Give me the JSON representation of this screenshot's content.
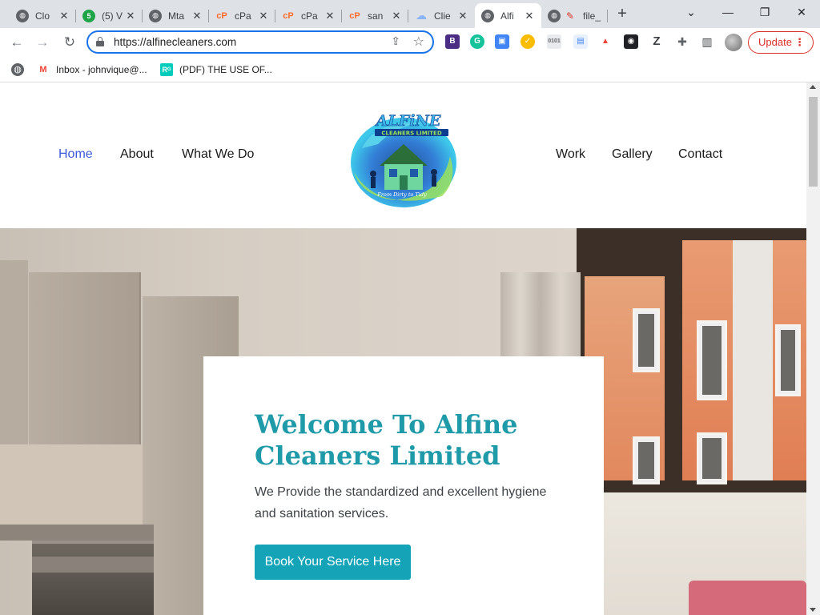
{
  "browser": {
    "tabs": [
      {
        "title": "Clo",
        "icon": "globe-icon"
      },
      {
        "title": "(5) V",
        "icon": "green-s-icon"
      },
      {
        "title": "Mta",
        "icon": "globe-icon"
      },
      {
        "title": "cPa",
        "icon": "cpanel-icon"
      },
      {
        "title": "cPa",
        "icon": "cpanel-icon"
      },
      {
        "title": "san",
        "icon": "cpanel-icon"
      },
      {
        "title": "Clie",
        "icon": "cloud-icon"
      },
      {
        "title": "Alfi",
        "icon": "globe-icon",
        "active": true
      },
      {
        "title": "file_",
        "icon": "file-icon"
      }
    ],
    "url": "https://alfinecleaners.com",
    "update_label": "Update",
    "bookmarks": [
      {
        "label": "",
        "icon": "globe-icon"
      },
      {
        "label": "Inbox - johnvique@...",
        "icon": "gmail-icon"
      },
      {
        "label": "(PDF) THE USE OF...",
        "icon": "researchgate-icon"
      }
    ],
    "colors": {
      "tabstrip_bg": "#dee1e6",
      "omnibox_focus": "#1a73e8",
      "update_red": "#d93025"
    }
  },
  "site": {
    "nav_left": [
      {
        "label": "Home",
        "active": true
      },
      {
        "label": "About"
      },
      {
        "label": "What We Do"
      }
    ],
    "nav_right": [
      {
        "label": "Work"
      },
      {
        "label": "Gallery"
      },
      {
        "label": "Contact"
      }
    ],
    "logo": {
      "brand": "ALFiNE",
      "subtitle": "CLEANERS LIMITED",
      "tagline": "From Dirty to Tidy"
    },
    "hero": {
      "title": "Welcome To Alfine Cleaners Limited",
      "subtitle": "We Provide the standardized and excellent hygiene and sanitation services.",
      "cta": "Book Your Service Here"
    },
    "colors": {
      "nav_active": "#3b5bdb",
      "hero_title": "#1f9aa8",
      "cta_bg": "#14a3b7"
    }
  }
}
